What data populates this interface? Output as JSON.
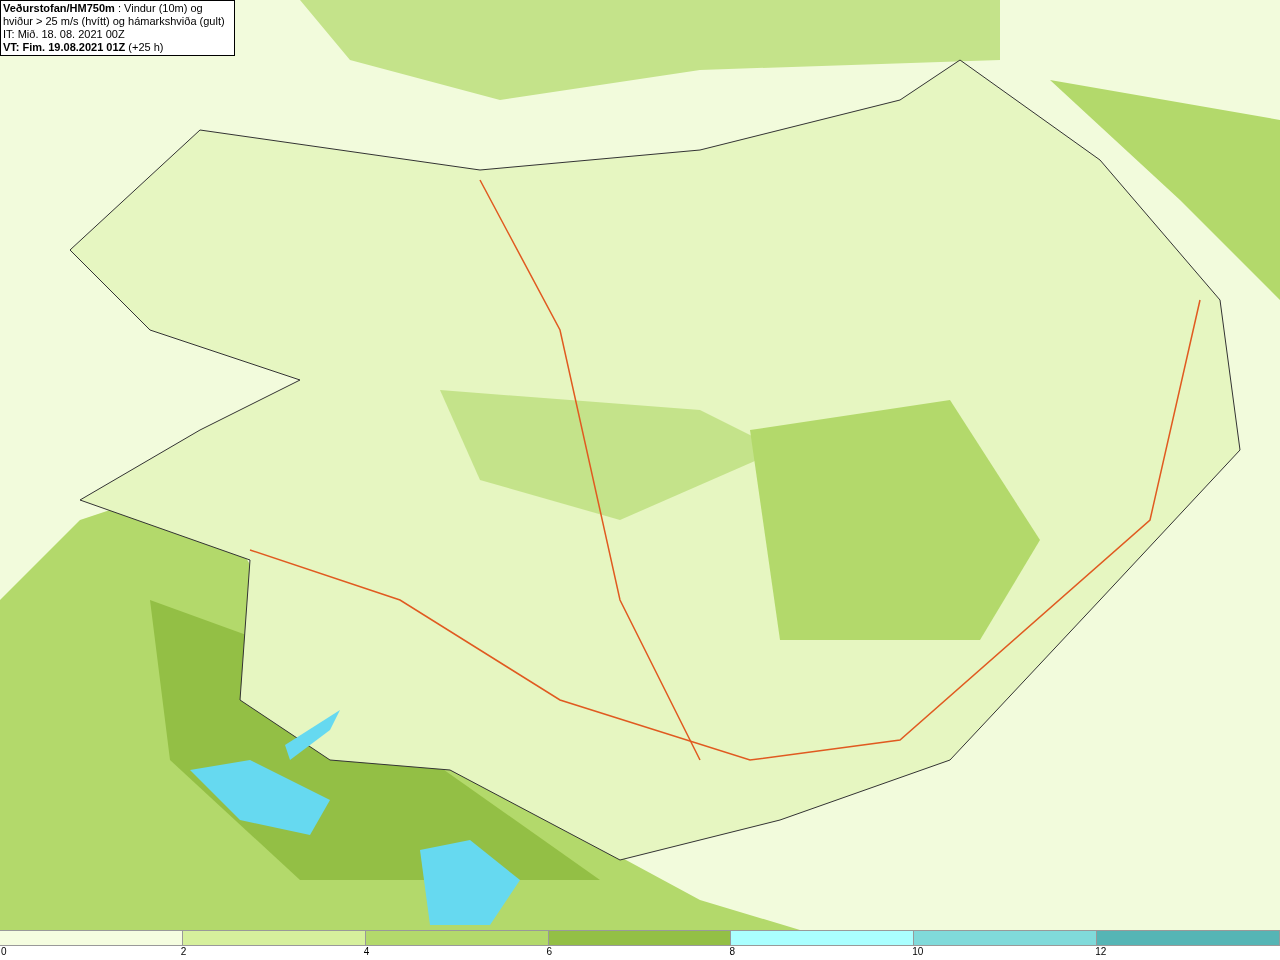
{
  "title_box": {
    "lines": [
      "**Veðurstofan/HM750m** : Vindur (10m) og",
      "hviður > 25 m/s (hvítt) og hámarkshviða (gult)",
      "IT: Mið. 18. 08. 2021 00Z",
      "**VT: Fim. 19.08.2021 01Z** (+25 h)"
    ]
  },
  "legend": {
    "bins": [
      {
        "color": "#f5fde0"
      },
      {
        "color": "#d6f09c"
      },
      {
        "color": "#b3d96b"
      },
      {
        "color": "#93bf45"
      },
      {
        "color": "#aaffff"
      },
      {
        "color": "#80dada"
      },
      {
        "color": "#55b5b5"
      }
    ],
    "labels": [
      "0",
      "2",
      "4",
      "6",
      "8",
      "10",
      "12"
    ]
  }
}
